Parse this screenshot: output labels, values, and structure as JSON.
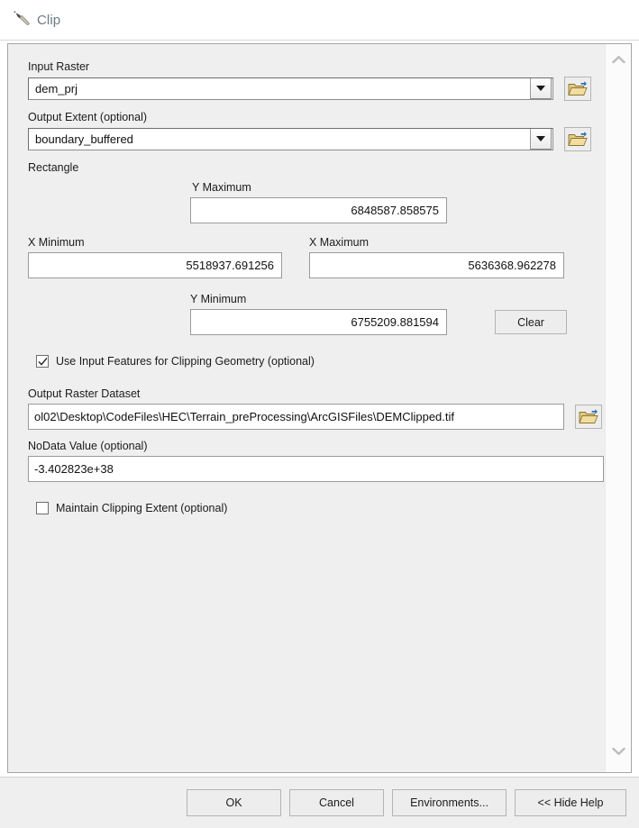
{
  "window": {
    "title": "Clip",
    "title_icon": "hammer-tool-icon",
    "title_color": "#6b7a86"
  },
  "parameters": {
    "input_raster": {
      "label": "Input Raster",
      "value": "dem_prj",
      "browse_icon": "open-folder-icon",
      "dropdown_icon": "chevron-down-icon"
    },
    "output_extent": {
      "label": "Output Extent (optional)",
      "value": "boundary_buffered",
      "browse_icon": "open-folder-icon",
      "dropdown_icon": "chevron-down-icon"
    },
    "rectangle": {
      "label": "Rectangle",
      "y_maximum_label": "Y Maximum",
      "y_maximum_value": "6848587.858575",
      "x_minimum_label": "X Minimum",
      "x_minimum_value": "5518937.691256",
      "x_maximum_label": "X Maximum",
      "x_maximum_value": "5636368.962278",
      "y_minimum_label": "Y Minimum",
      "y_minimum_value": "6755209.881594",
      "clear_label": "Clear"
    },
    "use_input_features": {
      "label": "Use Input Features for Clipping Geometry (optional)",
      "checked": true
    },
    "output_raster_dataset": {
      "label": "Output Raster Dataset",
      "value": "ol02\\Desktop\\CodeFiles\\HEC\\Terrain_preProcessing\\ArcGISFiles\\DEMClipped.tif",
      "browse_icon": "open-folder-icon"
    },
    "nodata_value": {
      "label": "NoData Value (optional)",
      "value": "-3.402823e+38"
    },
    "maintain_clipping_extent": {
      "label": "Maintain Clipping Extent (optional)",
      "checked": false
    }
  },
  "scrollbar": {
    "up_icon": "chevron-up-icon",
    "down_icon": "chevron-down-icon"
  },
  "footer": {
    "ok_label": "OK",
    "cancel_label": "Cancel",
    "environments_label": "Environments...",
    "hide_help_label": "<< Hide Help"
  },
  "colors": {
    "dialog_background": "#efefef",
    "field_background": "#ffffff",
    "button_face": "#ededed",
    "title_text": "#6b7a86",
    "folder_yellow": "#e8c86a",
    "arrow_blue": "#2f6fb5"
  }
}
